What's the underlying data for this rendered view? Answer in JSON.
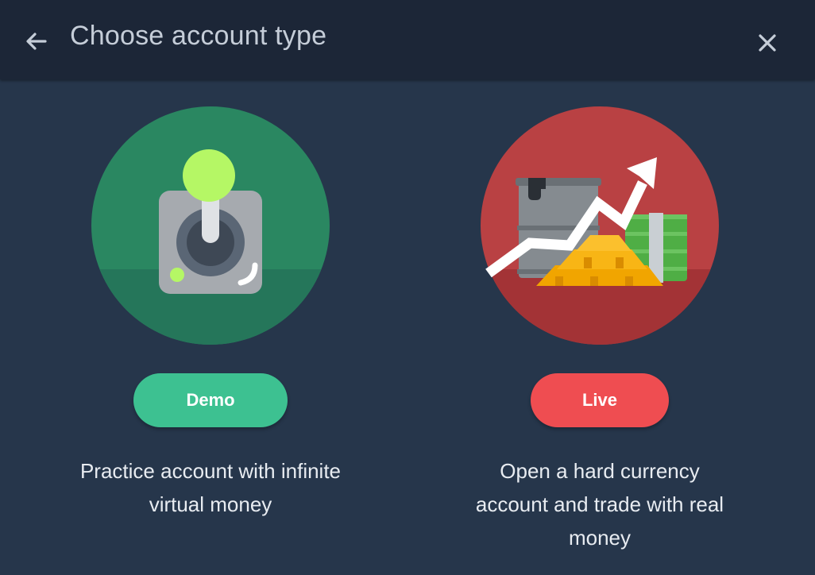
{
  "header": {
    "title": "Choose account type",
    "back_icon": "arrow-left-icon",
    "close_icon": "close-icon"
  },
  "cards": [
    {
      "id": "demo",
      "illustration": "joystick-icon",
      "button_label": "Demo",
      "description": "Practice account with infinite virtual money",
      "color": "#3dc191"
    },
    {
      "id": "live",
      "illustration": "rising-chart-assets-icon",
      "button_label": "Live",
      "description": "Open a hard currency account and trade with real money",
      "color": "#ef4d51"
    }
  ]
}
